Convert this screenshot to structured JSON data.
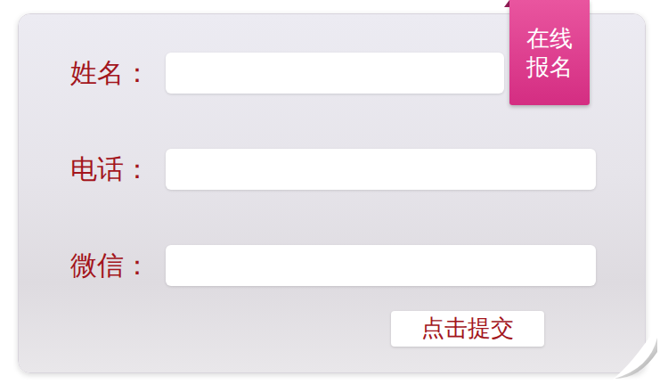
{
  "badge": {
    "label": "在线报名"
  },
  "form": {
    "fields": [
      {
        "label": "姓名："
      },
      {
        "label": "电话："
      },
      {
        "label": "微信："
      }
    ],
    "submit": "点击提交"
  }
}
